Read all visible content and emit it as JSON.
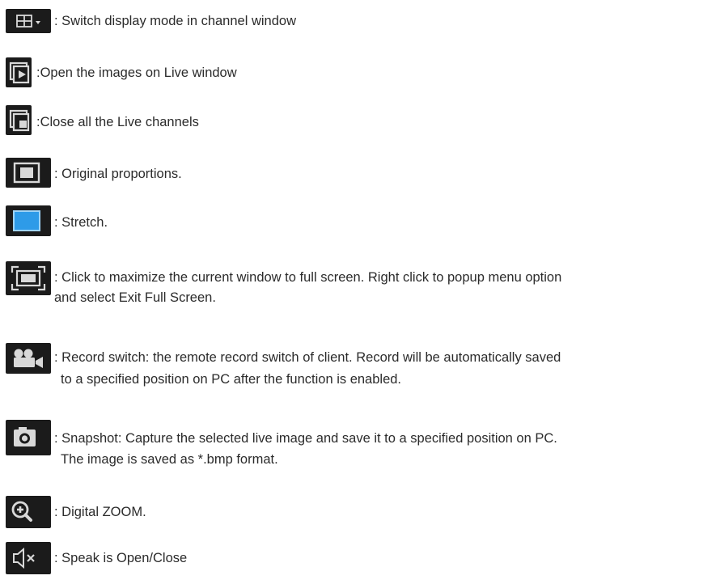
{
  "items": [
    {
      "icon": "display-mode-grid-icon",
      "text": ": Switch display mode in channel window"
    },
    {
      "icon": "open-live-window-icon",
      "text": ":Open the images on Live window"
    },
    {
      "icon": "close-live-channels-icon",
      "text": ":Close all the Live channels"
    },
    {
      "icon": "original-proportions-icon",
      "text": ": Original proportions."
    },
    {
      "icon": "stretch-icon",
      "text": ": Stretch."
    },
    {
      "icon": "fullscreen-icon",
      "text": ": Click to maximize the current window to full screen. Right click to popup menu option",
      "text2": "and select Exit Full Screen."
    },
    {
      "icon": "record-camera-icon",
      "text": ": Record switch: the remote record switch of client. Record will be automatically saved",
      "text2": "to a specified position on PC after the function is enabled."
    },
    {
      "icon": "snapshot-camera-icon",
      "text": ": Snapshot: Capture the selected live image and save it to a specified position on PC.",
      "text2": "The image is saved as *.bmp format."
    },
    {
      "icon": "digital-zoom-icon",
      "text": ": Digital ZOOM."
    },
    {
      "icon": "speaker-mute-icon",
      "text": ": Speak is Open/Close"
    }
  ],
  "colors": {
    "icon_bg": "#1b1b1b",
    "icon_fg": "#d8d8d8",
    "stretch_accent": "#2e9be8"
  }
}
